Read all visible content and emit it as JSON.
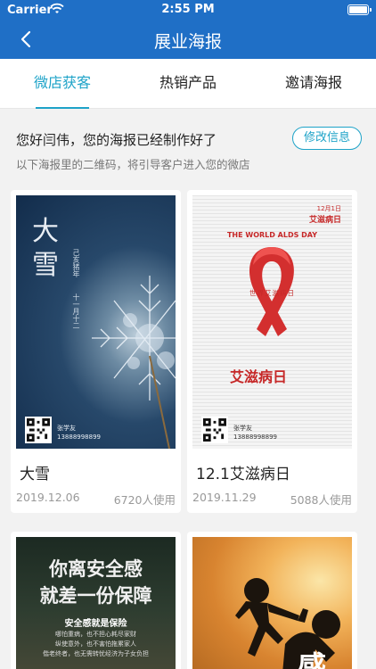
{
  "status": {
    "carrier": "Carrier",
    "time": "2:55 PM"
  },
  "nav": {
    "title": "展业海报"
  },
  "tabs": [
    {
      "label": "微店获客"
    },
    {
      "label": "热销产品"
    },
    {
      "label": "邀请海报"
    }
  ],
  "info": {
    "greeting": "您好闫伟，您的海报已经制作好了",
    "subtitle": "以下海报里的二维码，将引导客户进入您的微店",
    "edit_label": "修改信息"
  },
  "posters": [
    {
      "name": "大雪",
      "date": "2019.12.06",
      "uses": "6720人使用",
      "art": {
        "big": "大雪",
        "vertical_1": "己亥猪年",
        "vertical_2": "十一月十二",
        "qr_name": "张学友",
        "qr_phone": "13888998899"
      }
    },
    {
      "name": "12.1艾滋病日",
      "date": "2019.11.29",
      "uses": "5088人使用",
      "art": {
        "banner": "THE WORLD ALDS DAY",
        "date_small": "12月1日",
        "top_right": "艾滋病日",
        "red_line": "世界艾滋病日",
        "bottom": "艾滋病日",
        "qr_name": "张学友",
        "qr_phone": "13888998899"
      }
    },
    {
      "art": {
        "line1": "你离安全感",
        "line2": "就差一份保障",
        "sub": "安全感就是保险",
        "t1": "哪怕重病，也不担心耗尽家财",
        "t2": "纵使意外，也不害怕拖累家人",
        "t3": "偕老终者，也无需转忧经济为子女负担"
      }
    },
    {
      "art": {
        "glyph": "感"
      }
    }
  ],
  "colors": {
    "primary": "#1f6fc6",
    "accent": "#1ea3c8"
  }
}
